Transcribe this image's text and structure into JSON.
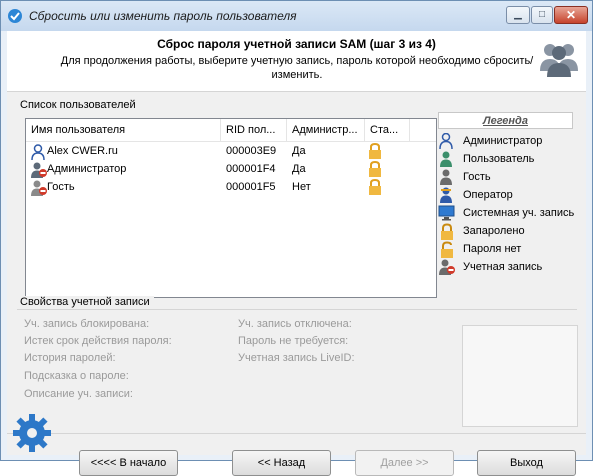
{
  "window": {
    "title": "Сбросить или изменить пароль пользователя"
  },
  "header": {
    "title": "Сброс пароля учетной записи SAM (шаг 3 из 4)",
    "subtitle": "Для продолжения работы, выберите учетную запись, пароль которой необходимо сбросить/изменить."
  },
  "users": {
    "group_label": "Список пользователей",
    "columns": [
      "Имя пользователя",
      "RID пол...",
      "Администр...",
      "Ста..."
    ],
    "rows": [
      {
        "name": "Alex CWER.ru",
        "rid": "000003E9",
        "admin": "Да",
        "icon": "user-icon",
        "status_icon": "lock-icon"
      },
      {
        "name": "Администратор",
        "rid": "000001F4",
        "admin": "Да",
        "icon": "admin-disabled-icon",
        "status_icon": "lock-icon"
      },
      {
        "name": "Гость",
        "rid": "000001F5",
        "admin": "Нет",
        "icon": "guest-disabled-icon",
        "status_icon": "lock-icon"
      }
    ]
  },
  "legend": {
    "title": "Легенда",
    "items": [
      {
        "label": "Администратор",
        "icon": "admin-icon",
        "color": "#2f5aa8"
      },
      {
        "label": "Пользователь",
        "icon": "user-icon",
        "color": "#3b8f6b"
      },
      {
        "label": "Гость",
        "icon": "guest-icon",
        "color": "#6b6b6b"
      },
      {
        "label": "Оператор",
        "icon": "operator-icon",
        "color": "#2f5aa8"
      },
      {
        "label": "Системная уч. запись",
        "icon": "computer-icon",
        "color": "#2f5aa8"
      },
      {
        "label": "Запаролено",
        "icon": "lock-closed-icon",
        "color": "#e0a020"
      },
      {
        "label": "Пароля нет",
        "icon": "lock-open-icon",
        "color": "#e0a020"
      },
      {
        "label": "Учетная запись",
        "icon": "disabled-account-icon",
        "color": "#c0392b"
      }
    ]
  },
  "properties": {
    "group_label": "Свойства учетной записи",
    "left": [
      "Уч. запись блокирована:",
      "Истек срок действия пароля:",
      "История паролей:",
      "Подсказка о пароле:",
      "Описание уч. записи:"
    ],
    "right": [
      "Уч. запись отключена:",
      "Пароль не требуется:",
      "Учетная запись LiveID:"
    ]
  },
  "buttons": {
    "home": "<<<< В начало",
    "back": "<< Назад",
    "next": "Далее >>",
    "exit": "Выход"
  }
}
